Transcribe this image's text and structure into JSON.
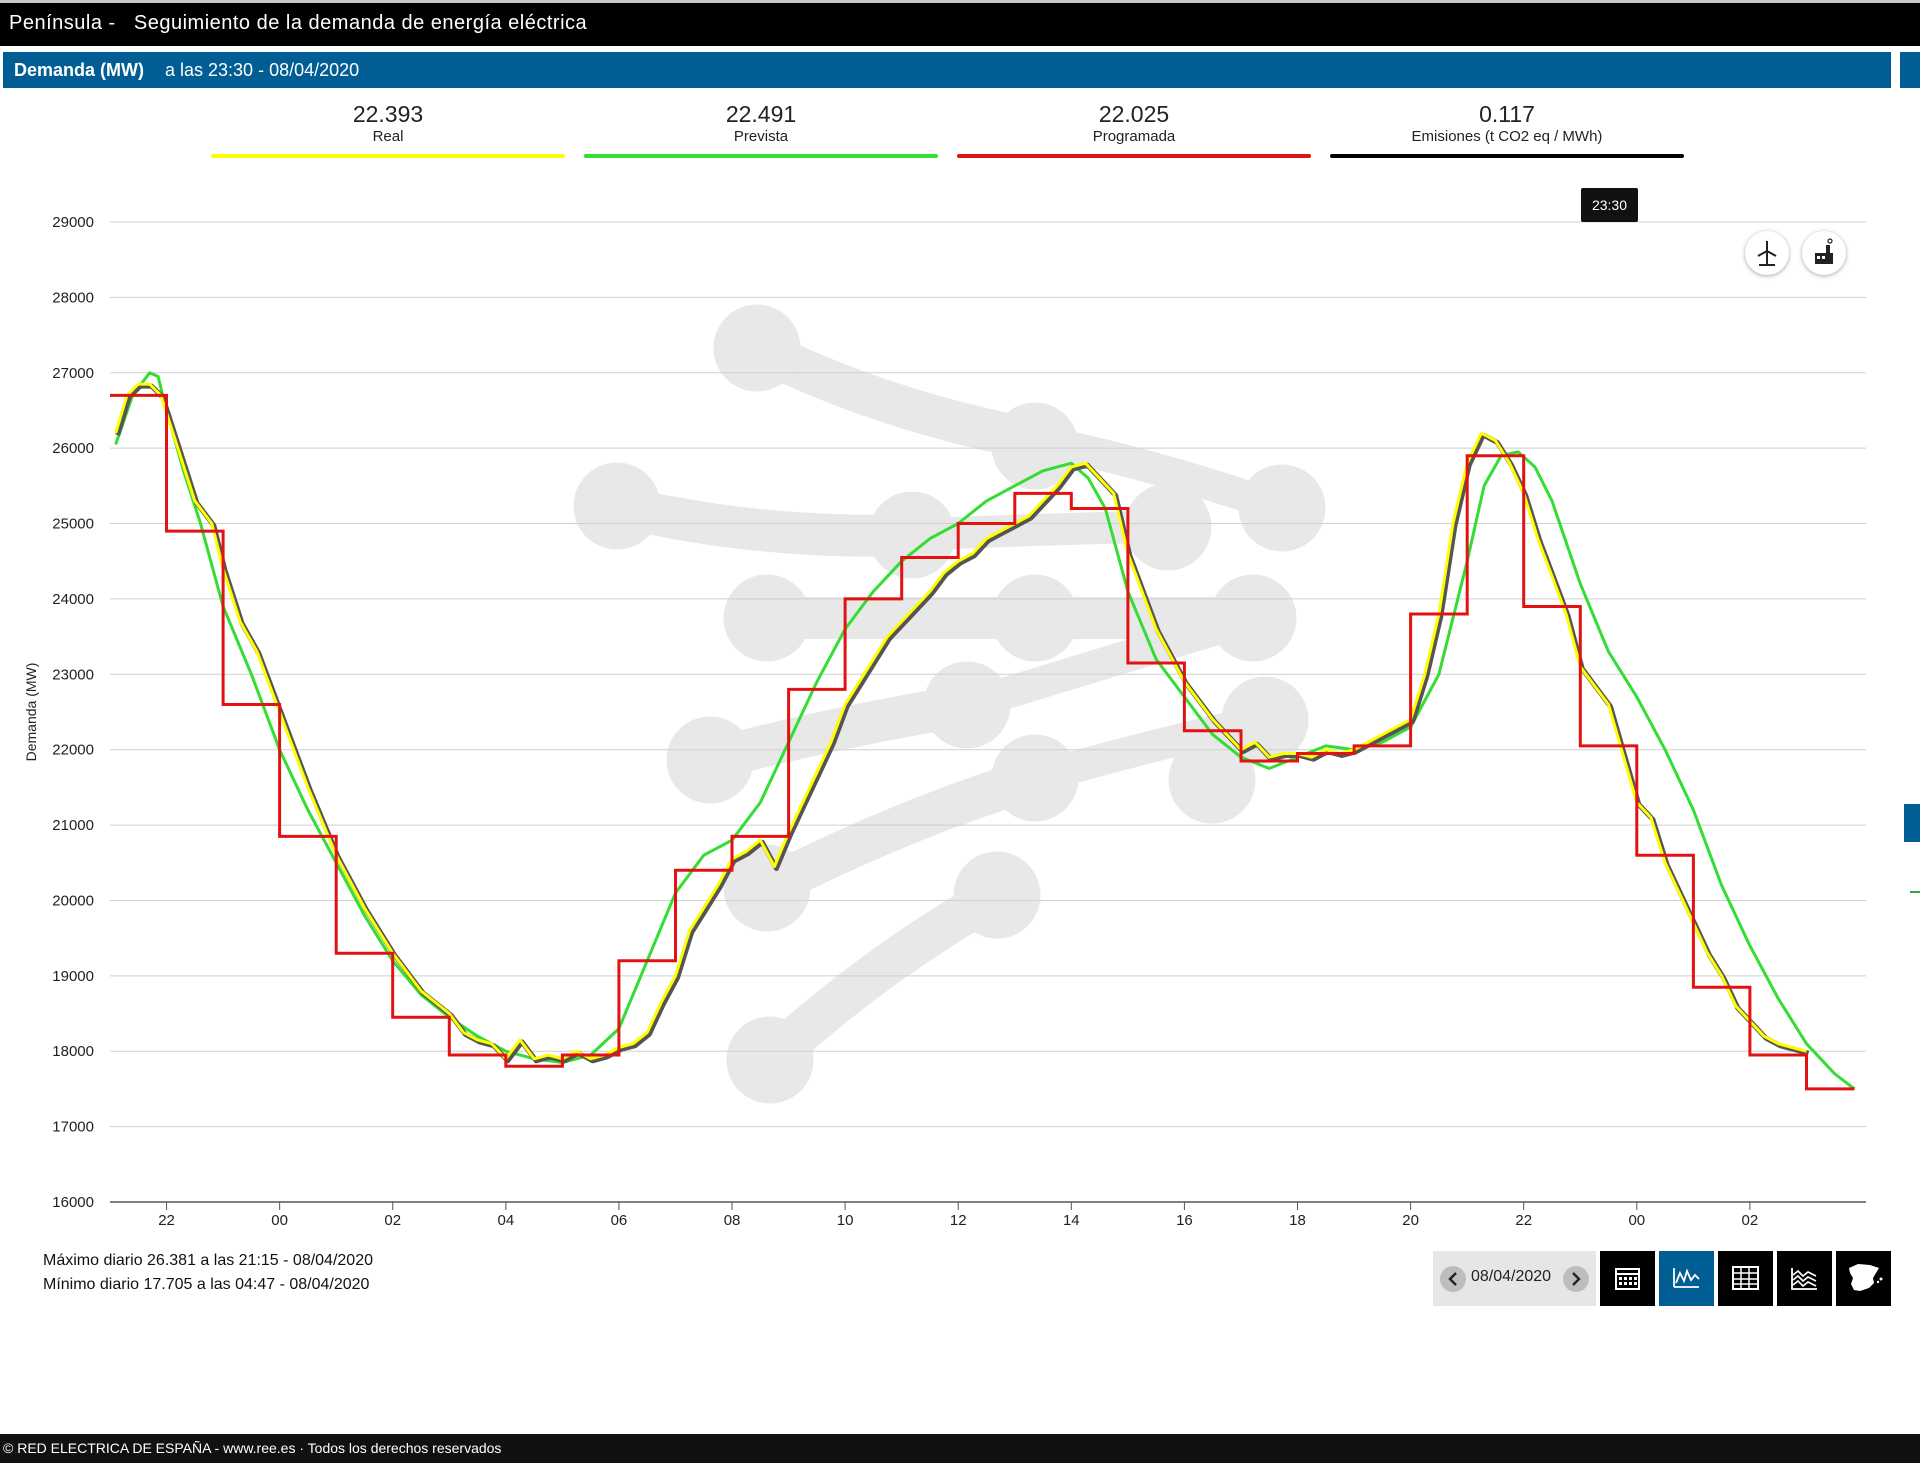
{
  "header": {
    "region": "Península",
    "separator": "-",
    "title": "Seguimiento de la demanda de energía eléctrica"
  },
  "subheader": {
    "metric": "Demanda (MW)",
    "time_label": "a las 23:30 - 08/04/2020"
  },
  "stats": [
    {
      "value": "22.393",
      "label": "Real",
      "color": "#ffff00"
    },
    {
      "value": "22.491",
      "label": "Prevista",
      "color": "#33dd33"
    },
    {
      "value": "22.025",
      "label": "Programada",
      "color": "#e31212"
    },
    {
      "value": "0.117",
      "label": "Emisiones (t CO2 eq / MWh)",
      "color": "#000000"
    }
  ],
  "tooltip": {
    "time": "23:30"
  },
  "icons": {
    "wind": "wind-turbine-icon",
    "factory": "factory-icon",
    "calendar": "calendar-icon",
    "line_chart": "line-chart-icon",
    "table": "table-icon",
    "area": "area-chart-icon",
    "map": "spain-map-icon"
  },
  "info": {
    "max": "Máximo diario 26.381 a las 21:15 - 08/04/2020",
    "min": "Mínimo diario 17.705 a las 04:47 - 08/04/2020"
  },
  "controls": {
    "date": "08/04/2020"
  },
  "footer": {
    "copyright": "© RED ELECTRICA DE ESPAÑA - www.ree.es · Todos los derechos reservados"
  },
  "chart_data": {
    "type": "line",
    "ylabel": "Demanda (MW)",
    "ylim": [
      16000,
      29000
    ],
    "yticks": [
      16000,
      17000,
      18000,
      19000,
      20000,
      21000,
      22000,
      23000,
      24000,
      25000,
      26000,
      27000,
      28000,
      29000
    ],
    "x_hour_range": [
      21,
      52
    ],
    "xticks": [
      {
        "h": 22,
        "label": "22"
      },
      {
        "h": 24,
        "label": "00"
      },
      {
        "h": 26,
        "label": "02"
      },
      {
        "h": 28,
        "label": "04"
      },
      {
        "h": 30,
        "label": "06"
      },
      {
        "h": 32,
        "label": "08"
      },
      {
        "h": 34,
        "label": "10"
      },
      {
        "h": 36,
        "label": "12"
      },
      {
        "h": 38,
        "label": "14"
      },
      {
        "h": 40,
        "label": "16"
      },
      {
        "h": 42,
        "label": "18"
      },
      {
        "h": 44,
        "label": "20"
      },
      {
        "h": 46,
        "label": "22"
      },
      {
        "h": 48,
        "label": "00"
      },
      {
        "h": 50,
        "label": "02"
      }
    ],
    "grid": true,
    "series": [
      {
        "name": "Prevista",
        "color": "#33dd33",
        "width": 3,
        "x": [
          21.1,
          21.4,
          21.7,
          21.85,
          22.0,
          22.3,
          22.6,
          23.0,
          23.5,
          24.0,
          24.5,
          25.0,
          25.5,
          26.0,
          26.5,
          27.0,
          27.5,
          28.0,
          28.5,
          29.0,
          29.5,
          30.0,
          30.5,
          31.0,
          31.5,
          32.0,
          32.5,
          33.0,
          33.5,
          34.0,
          34.5,
          35.0,
          35.5,
          36.0,
          36.5,
          37.0,
          37.5,
          38.0,
          38.3,
          38.6,
          39.0,
          39.5,
          40.0,
          40.5,
          41.0,
          41.5,
          42.0,
          42.5,
          43.0,
          43.5,
          44.0,
          44.5,
          45.0,
          45.3,
          45.6,
          45.9,
          46.2,
          46.5,
          47.0,
          47.5,
          48.0,
          48.5,
          49.0,
          49.5,
          50.0,
          50.5,
          51.0,
          51.5,
          51.85
        ],
        "y": [
          26050,
          26700,
          27000,
          26950,
          26500,
          25700,
          25000,
          23900,
          23000,
          22000,
          21200,
          20500,
          19800,
          19200,
          18750,
          18450,
          18200,
          18000,
          17900,
          17850,
          17950,
          18300,
          19200,
          20100,
          20600,
          20800,
          21300,
          22100,
          22900,
          23600,
          24100,
          24500,
          24800,
          25000,
          25300,
          25500,
          25700,
          25800,
          25600,
          25200,
          24100,
          23200,
          22700,
          22200,
          21900,
          21750,
          21900,
          22050,
          22000,
          22100,
          22300,
          23000,
          24500,
          25500,
          25900,
          25950,
          25750,
          25300,
          24200,
          23300,
          22700,
          22000,
          21200,
          20200,
          19400,
          18700,
          18100,
          17700,
          17500
        ]
      },
      {
        "name": "Real",
        "color": "#ffff00",
        "width": 3,
        "x": [
          21.1,
          21.3,
          21.5,
          21.7,
          21.9,
          22.2,
          22.5,
          22.8,
          23.0,
          23.3,
          23.6,
          24.0,
          24.5,
          25.0,
          25.5,
          26.0,
          26.5,
          27.0,
          27.25,
          27.5,
          27.75,
          28.0,
          28.25,
          28.5,
          28.75,
          29.0,
          29.25,
          29.5,
          29.75,
          30.0,
          30.25,
          30.5,
          30.75,
          31.0,
          31.25,
          31.5,
          31.75,
          32.0,
          32.25,
          32.5,
          32.75,
          33.0,
          33.25,
          33.5,
          33.75,
          34.0,
          34.25,
          34.5,
          34.75,
          35.0,
          35.25,
          35.5,
          35.75,
          36.0,
          36.25,
          36.5,
          36.75,
          37.0,
          37.25,
          37.5,
          37.75,
          38.0,
          38.25,
          38.5,
          38.75,
          39.0,
          39.5,
          40.0,
          40.5,
          41.0,
          41.25,
          41.5,
          41.75,
          42.0,
          42.25,
          42.5,
          42.75,
          43.0,
          43.25,
          43.5,
          43.75,
          44.0,
          44.25,
          44.5,
          44.75,
          45.0,
          45.25,
          45.5,
          45.75,
          46.0,
          46.25,
          46.5,
          46.75,
          47.0,
          47.5,
          48.0,
          48.25,
          48.5,
          48.75,
          49.0,
          49.25,
          49.5,
          49.75,
          50.0,
          50.25,
          50.5,
          50.75,
          51.0
        ],
        "y": [
          26200,
          26700,
          26850,
          26850,
          26700,
          26000,
          25300,
          25000,
          24400,
          23700,
          23300,
          22500,
          21500,
          20600,
          19900,
          19300,
          18800,
          18500,
          18250,
          18150,
          18100,
          17900,
          18150,
          17900,
          17950,
          17900,
          18000,
          17900,
          17950,
          18050,
          18100,
          18250,
          18650,
          19000,
          19600,
          19900,
          20200,
          20550,
          20650,
          20800,
          20450,
          20900,
          21300,
          21700,
          22100,
          22600,
          22900,
          23200,
          23500,
          23700,
          23900,
          24100,
          24350,
          24500,
          24600,
          24800,
          24900,
          25000,
          25100,
          25300,
          25500,
          25750,
          25800,
          25600,
          25400,
          24600,
          23600,
          22900,
          22400,
          22000,
          22100,
          21900,
          21950,
          21950,
          21900,
          22000,
          21950,
          22000,
          22100,
          22200,
          22300,
          22400,
          23000,
          23800,
          25000,
          25800,
          26200,
          26100,
          25800,
          25400,
          24800,
          24300,
          23800,
          23100,
          22600,
          21300,
          21100,
          20500,
          20100,
          19700,
          19300,
          19000,
          18600,
          18400,
          18200,
          18100,
          18050,
          18000
        ]
      },
      {
        "name": "Programada",
        "color": "#e31212",
        "width": 3,
        "step": true,
        "x": [
          21.0,
          22.0,
          23.0,
          24.0,
          25.0,
          26.0,
          27.0,
          28.0,
          29.0,
          30.0,
          31.0,
          32.0,
          33.0,
          34.0,
          35.0,
          36.0,
          37.0,
          38.0,
          39.0,
          40.0,
          41.0,
          42.0,
          43.0,
          44.0,
          45.0,
          46.0,
          47.0,
          48.0,
          49.0,
          50.0,
          51.0
        ],
        "y": [
          26700,
          24900,
          22600,
          20850,
          19300,
          18450,
          17950,
          17800,
          17950,
          19200,
          20400,
          20850,
          22800,
          24000,
          24550,
          25000,
          25400,
          25200,
          23150,
          22250,
          21850,
          21950,
          22050,
          23800,
          25900,
          23900,
          22050,
          20600,
          18850,
          17950,
          17500
        ],
        "x_end": 51.85
      }
    ]
  }
}
